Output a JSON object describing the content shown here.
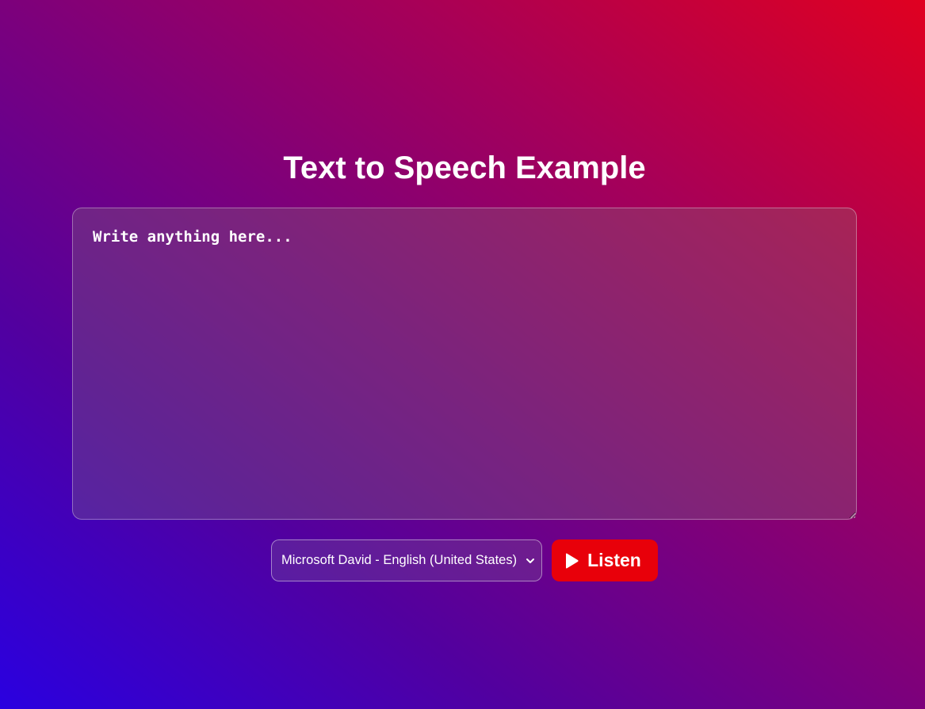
{
  "header": {
    "title": "Text to Speech Example"
  },
  "editor": {
    "placeholder": "Write anything here...",
    "value": ""
  },
  "controls": {
    "voice_select": {
      "selected": "Microsoft David - English (United States)",
      "icon": "chevron-down-icon"
    },
    "listen_button": {
      "label": "Listen",
      "icon": "play-icon",
      "color": "#e8000a"
    }
  },
  "theme": {
    "gradient_start": "#2a00e0",
    "gradient_mid": "#7c007c",
    "gradient_end": "#e00020"
  }
}
